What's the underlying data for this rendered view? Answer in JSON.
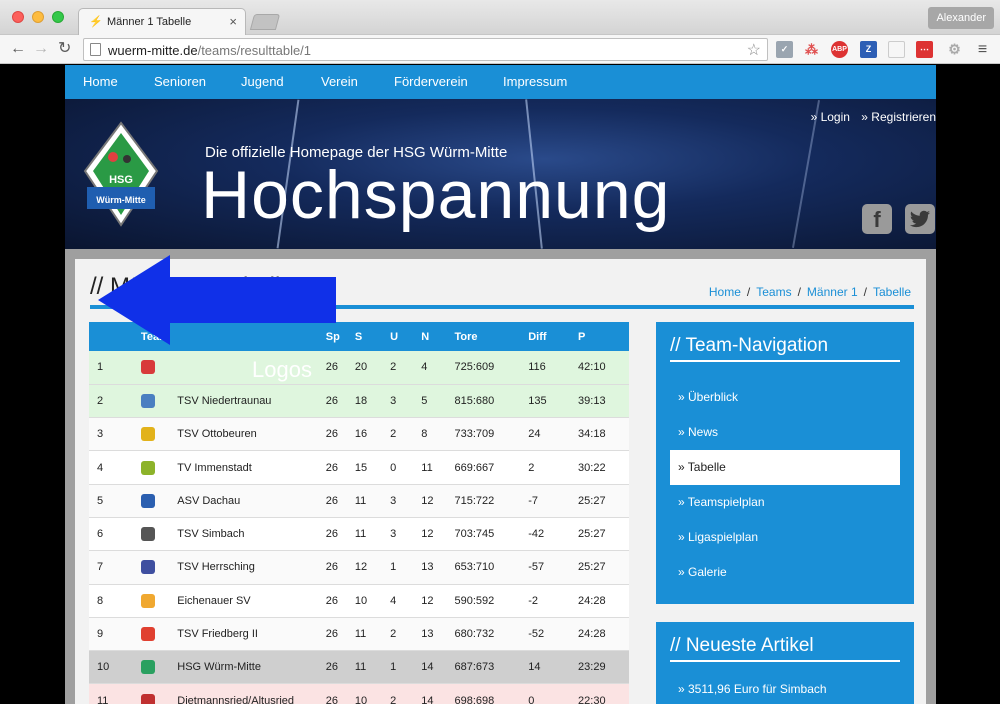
{
  "browser": {
    "tab_title": "Männer 1 Tabelle",
    "tab_close": "×",
    "user": "Alexander",
    "url_domain": "wuerm-mitte.de",
    "url_path": "/teams/resulttable/1"
  },
  "nav": {
    "items": [
      "Home",
      "Senioren",
      "Jugend",
      "Verein",
      "Förderverein",
      "Impressum"
    ]
  },
  "hero": {
    "login": "» Login",
    "register": "» Registrieren",
    "tagline": "Die offizielle Homepage der HSG Würm-Mitte",
    "title": "Hochspannung",
    "logo_text_top": "HSG",
    "logo_text_bottom": "Würm-Mitte",
    "facebook": "f"
  },
  "content": {
    "page_title": "// Männer 1 Tabelle",
    "breadcrumb": [
      "Home",
      "Teams",
      "Männer 1",
      "Tabelle"
    ],
    "breadcrumb_sep": "/"
  },
  "table": {
    "headers": [
      "",
      "Team",
      "",
      "Sp",
      "S",
      "U",
      "N",
      "Tore",
      "Diff",
      "P"
    ],
    "rows": [
      {
        "pos": "1",
        "team": "",
        "sp": "26",
        "s": "20",
        "u": "2",
        "n": "4",
        "tore": "725:609",
        "diff": "116",
        "p": "42:10",
        "logo_color": "#d83a3a",
        "style": "promo"
      },
      {
        "pos": "2",
        "team": "TSV Niedertraunau",
        "sp": "26",
        "s": "18",
        "u": "3",
        "n": "5",
        "tore": "815:680",
        "diff": "135",
        "p": "39:13",
        "logo_color": "#4a7fc1",
        "style": "promo"
      },
      {
        "pos": "3",
        "team": "TSV Ottobeuren",
        "sp": "26",
        "s": "16",
        "u": "2",
        "n": "8",
        "tore": "733:709",
        "diff": "24",
        "p": "34:18",
        "logo_color": "#e2b21a",
        "style": "zebra"
      },
      {
        "pos": "4",
        "team": "TV Immenstadt",
        "sp": "26",
        "s": "15",
        "u": "0",
        "n": "11",
        "tore": "669:667",
        "diff": "2",
        "p": "30:22",
        "logo_color": "#8db32a",
        "style": "plain"
      },
      {
        "pos": "5",
        "team": "ASV Dachau",
        "sp": "26",
        "s": "11",
        "u": "3",
        "n": "12",
        "tore": "715:722",
        "diff": "-7",
        "p": "25:27",
        "logo_color": "#2b5fb0",
        "style": "zebra"
      },
      {
        "pos": "6",
        "team": "TSV Simbach",
        "sp": "26",
        "s": "11",
        "u": "3",
        "n": "12",
        "tore": "703:745",
        "diff": "-42",
        "p": "25:27",
        "logo_color": "#555555",
        "style": "plain"
      },
      {
        "pos": "7",
        "team": "TSV Herrsching",
        "sp": "26",
        "s": "12",
        "u": "1",
        "n": "13",
        "tore": "653:710",
        "diff": "-57",
        "p": "25:27",
        "logo_color": "#3f4fa0",
        "style": "zebra"
      },
      {
        "pos": "8",
        "team": "Eichenauer SV",
        "sp": "26",
        "s": "10",
        "u": "4",
        "n": "12",
        "tore": "590:592",
        "diff": "-2",
        "p": "24:28",
        "logo_color": "#f0a830",
        "style": "plain"
      },
      {
        "pos": "9",
        "team": "TSV Friedberg II",
        "sp": "26",
        "s": "11",
        "u": "2",
        "n": "13",
        "tore": "680:732",
        "diff": "-52",
        "p": "24:28",
        "logo_color": "#e04030",
        "style": "zebra"
      },
      {
        "pos": "10",
        "team": "HSG Würm-Mitte",
        "sp": "26",
        "s": "11",
        "u": "1",
        "n": "14",
        "tore": "687:673",
        "diff": "14",
        "p": "23:29",
        "logo_color": "#2aa060",
        "style": "own"
      },
      {
        "pos": "11",
        "team": "Dietmannsried/Altusried",
        "sp": "26",
        "s": "10",
        "u": "2",
        "n": "14",
        "tore": "698:698",
        "diff": "0",
        "p": "22:30",
        "logo_color": "#c03030",
        "style": "releg"
      }
    ]
  },
  "annotation": {
    "label": "Logos",
    "color": "#1030e8"
  },
  "sidebar": {
    "team_nav_title": "// Team-Navigation",
    "team_nav_items": [
      "» Überblick",
      "» News",
      "» Tabelle",
      "» Teamspielplan",
      "» Ligaspielplan",
      "» Galerie"
    ],
    "active_index": 2,
    "articles_title": "// Neueste Artikel",
    "articles": [
      "» 3511,96 Euro für Simbach"
    ]
  },
  "colors": {
    "accent": "#1a8fd6"
  }
}
